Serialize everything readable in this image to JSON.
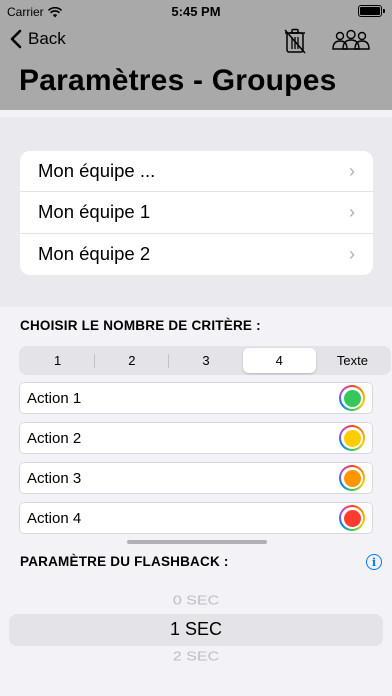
{
  "status_bar": {
    "carrier": "Carrier",
    "time": "5:45 PM"
  },
  "nav": {
    "back_label": "Back",
    "title": "Paramètres - Groupes"
  },
  "teams": [
    {
      "label": "Mon équipe ..."
    },
    {
      "label": "Mon équipe 1"
    },
    {
      "label": "Mon équipe 2"
    }
  ],
  "criteria": {
    "heading": "CHOISIR LE NOMBRE DE CRITÈRE :",
    "options": [
      "1",
      "2",
      "3",
      "4",
      "Texte"
    ],
    "selected": "4"
  },
  "actions": [
    {
      "label": "Action 1",
      "color": "#34c759"
    },
    {
      "label": "Action 2",
      "color": "#ffcc00"
    },
    {
      "label": "Action 3",
      "color": "#ff9500"
    },
    {
      "label": "Action 4",
      "color": "#ff3b30"
    }
  ],
  "flashback": {
    "heading": "PARAMÈTRE DU FLASHBACK :",
    "picker_options": [
      "0 SEC",
      "1 SEC",
      "2 SEC"
    ],
    "selected": "1 SEC"
  },
  "colors": {
    "accent": "#007aff",
    "nav_bg": "#a9a9a9"
  }
}
